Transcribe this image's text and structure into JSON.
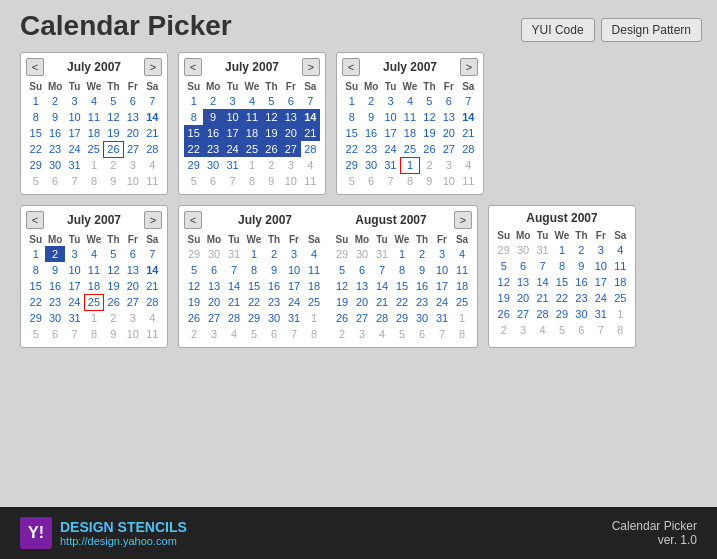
{
  "page": {
    "title": "Calendar Picker",
    "buttons": {
      "yui_code": "YUI Code",
      "design_pattern": "Design Pattern"
    }
  },
  "calendars": [
    {
      "id": "cal1",
      "title": "July 2007",
      "type": "single",
      "weeks": [
        [
          "1",
          "2",
          "3",
          "4",
          "5",
          "6",
          "7"
        ],
        [
          "8",
          "9",
          "10",
          "11",
          "12",
          "13",
          "14"
        ],
        [
          "15",
          "16",
          "17",
          "18",
          "19",
          "20",
          "21"
        ],
        [
          "22",
          "23",
          "24",
          "25",
          "26",
          "27",
          "28"
        ],
        [
          "29",
          "30",
          "31",
          "1",
          "2",
          "3",
          "4"
        ],
        [
          "5",
          "6",
          "7",
          "8",
          "9",
          "10",
          "11"
        ]
      ],
      "today": "26",
      "today_week": 3,
      "today_col": 4,
      "bold": [
        "14"
      ],
      "other_month_starts": [
        [
          "4",
          "1"
        ],
        [
          "4",
          "2"
        ],
        [
          "4",
          "3"
        ],
        [
          "4",
          "4"
        ],
        [
          "5",
          "0"
        ],
        [
          "5",
          "1"
        ],
        [
          "5",
          "2"
        ],
        [
          "5",
          "3"
        ],
        [
          "5",
          "4"
        ],
        [
          "5",
          "5"
        ],
        [
          "5",
          "6"
        ]
      ]
    },
    {
      "id": "cal2",
      "title": "July 2007",
      "type": "range",
      "range_start_week": 1,
      "range_start_col": 1,
      "range_end_week": 2,
      "range_end_col": 6,
      "weeks": [
        [
          "1",
          "2",
          "3",
          "4",
          "5",
          "6",
          "7"
        ],
        [
          "8",
          "9",
          "10",
          "11",
          "12",
          "13",
          "14"
        ],
        [
          "15",
          "16",
          "17",
          "18",
          "19",
          "20",
          "21"
        ],
        [
          "22",
          "23",
          "24",
          "25",
          "26",
          "27",
          "28"
        ],
        [
          "29",
          "30",
          "31",
          "1",
          "2",
          "3",
          "4"
        ],
        [
          "5",
          "6",
          "7",
          "8",
          "9",
          "10",
          "11"
        ]
      ],
      "today": "26",
      "bold": [
        "14"
      ],
      "other_month_rows": [
        4,
        5
      ]
    },
    {
      "id": "cal3",
      "title": "July 2007",
      "type": "single",
      "weeks": [
        [
          "1",
          "2",
          "3",
          "4",
          "5",
          "6",
          "7"
        ],
        [
          "8",
          "9",
          "10",
          "11",
          "12",
          "13",
          "14"
        ],
        [
          "15",
          "16",
          "17",
          "18",
          "19",
          "20",
          "21"
        ],
        [
          "22",
          "23",
          "24",
          "25",
          "26",
          "27",
          "28"
        ],
        [
          "29",
          "30",
          "31",
          "1",
          "2",
          "3",
          "4"
        ],
        [
          "5",
          "6",
          "7",
          "8",
          "9",
          "10",
          "11"
        ]
      ],
      "today": "1",
      "today_week": 4,
      "today_col": 1,
      "bold": [
        "14"
      ],
      "other_month_rows": [
        4,
        5
      ]
    }
  ],
  "bottom_calendars": [
    {
      "id": "cal4",
      "title": "July 2007",
      "type": "single",
      "weeks": [
        [
          "1",
          "2",
          "3",
          "4",
          "5",
          "6",
          "7"
        ],
        [
          "8",
          "9",
          "10",
          "11",
          "12",
          "13",
          "14"
        ],
        [
          "15",
          "16",
          "17",
          "18",
          "19",
          "20",
          "21"
        ],
        [
          "22",
          "23",
          "24",
          "25",
          "26",
          "27",
          "28"
        ],
        [
          "29",
          "30",
          "31",
          "1",
          "2",
          "3",
          "4"
        ],
        [
          "5",
          "6",
          "7",
          "8",
          "9",
          "10",
          "11"
        ]
      ],
      "today": "25",
      "bold": [
        "14"
      ],
      "highlighted": [
        "2"
      ],
      "other_month_rows": [
        4,
        5
      ]
    },
    {
      "id": "cal5",
      "title1": "July 2007",
      "title2": "August 2007",
      "type": "two-month",
      "weeks_left": [
        [
          "29",
          "30",
          "31",
          "1",
          "2",
          "3",
          "4"
        ],
        [
          "5",
          "6",
          "7",
          "8",
          "9",
          "10",
          "11"
        ],
        [
          "12",
          "13",
          "14",
          "15",
          "16",
          "17",
          "18"
        ],
        [
          "19",
          "20",
          "21",
          "22",
          "23",
          "24",
          "25"
        ],
        [
          "26",
          "27",
          "28",
          "29",
          "30",
          "31",
          "1"
        ],
        [
          "2",
          "3",
          "4",
          "5",
          "6",
          "7",
          "8"
        ]
      ],
      "weeks_right": [
        [
          "29",
          "30",
          "31",
          "1",
          "2",
          "3",
          "4"
        ],
        [
          "5",
          "6",
          "7",
          "8",
          "9",
          "10",
          "11"
        ],
        [
          "12",
          "13",
          "14",
          "15",
          "16",
          "17",
          "18"
        ],
        [
          "19",
          "20",
          "21",
          "22",
          "23",
          "24",
          "25"
        ],
        [
          "26",
          "27",
          "28",
          "29",
          "30",
          "31",
          "1"
        ],
        [
          "2",
          "3",
          "4",
          "5",
          "6",
          "7",
          "8"
        ]
      ]
    },
    {
      "id": "cal6",
      "title": "August 2007",
      "type": "no-nav",
      "weeks": [
        [
          "29",
          "30",
          "31",
          "1",
          "2",
          "3",
          "4"
        ],
        [
          "5",
          "6",
          "7",
          "8",
          "9",
          "10",
          "11"
        ],
        [
          "12",
          "13",
          "14",
          "15",
          "16",
          "17",
          "18"
        ],
        [
          "19",
          "20",
          "21",
          "22",
          "23",
          "24",
          "25"
        ],
        [
          "26",
          "27",
          "28",
          "29",
          "30",
          "31",
          "1"
        ],
        [
          "2",
          "3",
          "4",
          "5",
          "6",
          "7",
          "8"
        ]
      ],
      "other_month_rows": [
        0,
        5
      ]
    }
  ],
  "footer": {
    "logo": "Y!",
    "brand": "DESIGN STENCILS",
    "url": "http://design.yahoo.com",
    "product": "Calendar Picker",
    "version": "ver. 1.0"
  },
  "days_header": [
    "Su",
    "Mo",
    "Tu",
    "We",
    "Th",
    "Fr",
    "Sa"
  ]
}
